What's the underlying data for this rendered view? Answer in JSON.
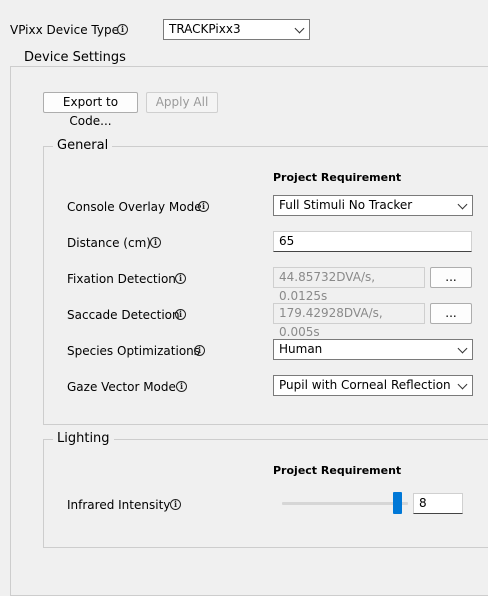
{
  "top": {
    "device_type_label": "VPixx Device Type",
    "device_type_value": "TRACKPixx3"
  },
  "device_settings": {
    "title": "Device Settings",
    "export_button": "Export to Code...",
    "apply_all_button": "Apply All"
  },
  "general": {
    "title": "General",
    "column_header": "Project Requirement",
    "console_overlay_mode": {
      "label": "Console Overlay Mode",
      "value": "Full Stimuli No Tracker"
    },
    "distance": {
      "label": "Distance (cm)",
      "value": "65"
    },
    "fixation_detection": {
      "label": "Fixation Detection",
      "value": "44.85732DVA/s, 0.0125s",
      "button": "..."
    },
    "saccade_detection": {
      "label": "Saccade Detection",
      "value": "179.42928DVA/s, 0.005s",
      "button": "..."
    },
    "species_optimizations": {
      "label": "Species Optimizations",
      "value": "Human"
    },
    "gaze_vector_mode": {
      "label": "Gaze Vector Mode",
      "value": "Pupil with Corneal Reflection"
    }
  },
  "lighting": {
    "title": "Lighting",
    "column_header": "Project Requirement",
    "infrared_intensity": {
      "label": "Infrared Intensity",
      "value": "8",
      "slider_fraction": 0.95
    }
  },
  "colors": {
    "accent": "#0078d7",
    "background": "#f0f0f0"
  }
}
